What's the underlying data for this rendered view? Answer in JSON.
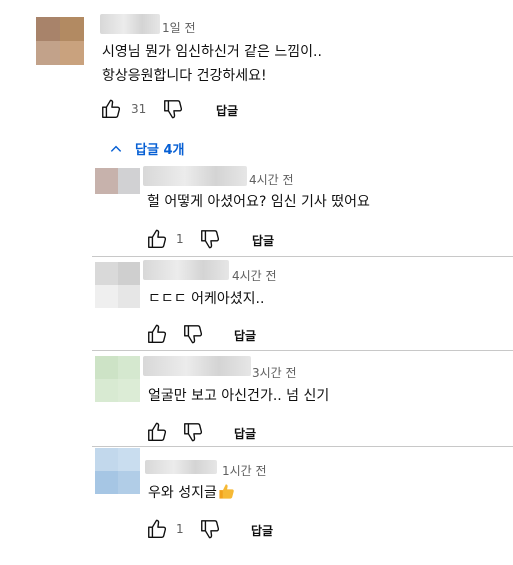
{
  "colors": {
    "link_blue": "#065fd4",
    "meta_gray": "#606060",
    "text": "#0f0f0f",
    "thumb_emoji": "#f2a31b"
  },
  "icons": {
    "like": "thumbs-up-icon",
    "dislike": "thumbs-down-icon",
    "toggle": "chevron-up-icon",
    "emoji": "thumbs-up-emoji"
  },
  "main_comment": {
    "time": "1일 전",
    "lines": [
      "시영님 뭔가 임신하신거 같은 느낌이..",
      "항상응원합니다 건강하세요!"
    ],
    "likes": "31",
    "reply_label": "답글"
  },
  "replies_toggle": {
    "label": "답글 4개"
  },
  "replies": [
    {
      "time": "4시간 전",
      "text": "헐 어떻게 아셨어요? 임신 기사 떴어요",
      "likes": "1",
      "reply_label": "답글"
    },
    {
      "time": "4시간 전",
      "text": "ㄷㄷㄷ 어케아셨지..",
      "likes": "",
      "reply_label": "답글"
    },
    {
      "time": "3시간 전",
      "text": "얼굴만 보고 아신건가.. 넘 신기",
      "likes": "",
      "reply_label": "답글"
    },
    {
      "time": "1시간 전",
      "text": "우와 성지글",
      "likes": "1",
      "reply_label": "답글"
    }
  ]
}
